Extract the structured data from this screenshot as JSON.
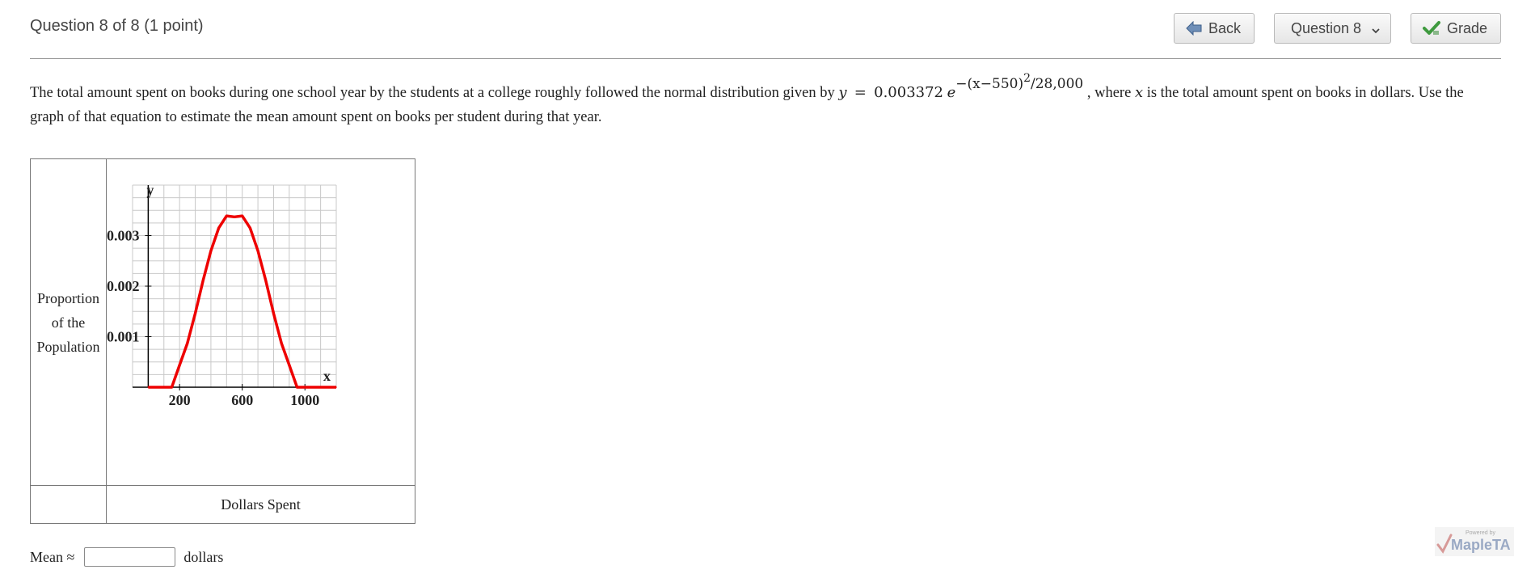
{
  "header": {
    "question_title": "Question 8 of 8 (1 point)",
    "back_label": "Back",
    "question_select_value": "Question 8",
    "grade_label": "Grade"
  },
  "problem": {
    "text_part1": "The total amount spent on books during one school year by the students at a college roughly followed the normal distribution given by ",
    "eq_y": "y",
    "eq_equals": "=",
    "eq_coefficient": "0.003372",
    "eq_e": "e",
    "eq_exponent": "−(x−550)",
    "eq_square": "2",
    "eq_divisor": "/28,000",
    "text_part2": " , where ",
    "eq_x": "x",
    "text_part3": " is the total amount spent on books in dollars. Use the graph of that equation to estimate the mean amount spent on books per student during that year."
  },
  "figure": {
    "y_axis_label_line1": "Proportion",
    "y_axis_label_line2": "of the",
    "y_axis_label_line3": "Population",
    "x_axis_caption": "Dollars Spent"
  },
  "chart_data": {
    "type": "line",
    "function": "y = 0.003372 e^(-(x-550)^2/28000)",
    "series": [
      {
        "x": [
          0,
          100,
          150,
          200,
          250,
          300,
          350,
          400,
          450,
          500,
          550,
          600,
          650,
          700,
          750,
          800,
          850,
          900,
          950,
          1000,
          1100,
          1200
        ],
        "y": [
          0.0,
          0.0,
          0.0,
          0.00044,
          0.00087,
          0.00146,
          0.00211,
          0.0027,
          0.00315,
          0.00339,
          0.003372,
          0.00339,
          0.00315,
          0.0027,
          0.00211,
          0.00146,
          0.00087,
          0.00044,
          0.0,
          0.0,
          0.0,
          0.0
        ]
      }
    ],
    "x_axis_letter": "x",
    "y_axis_letter": "y",
    "x_ticks": [
      200,
      600,
      1000
    ],
    "x_tick_labels": [
      "200",
      "600",
      "1000"
    ],
    "y_ticks": [
      0.001,
      0.002,
      0.003
    ],
    "y_tick_labels": [
      "0.001",
      "0.002",
      "0.003"
    ],
    "xlim": [
      -100,
      1200
    ],
    "ylim": [
      0,
      0.004
    ],
    "grid": true,
    "line_color": "#ee0000"
  },
  "answer": {
    "prefix": "Mean ≈",
    "value": "",
    "suffix": "dollars"
  },
  "branding": {
    "powered_by": "Powered by",
    "logo_text": "MapleTA"
  }
}
